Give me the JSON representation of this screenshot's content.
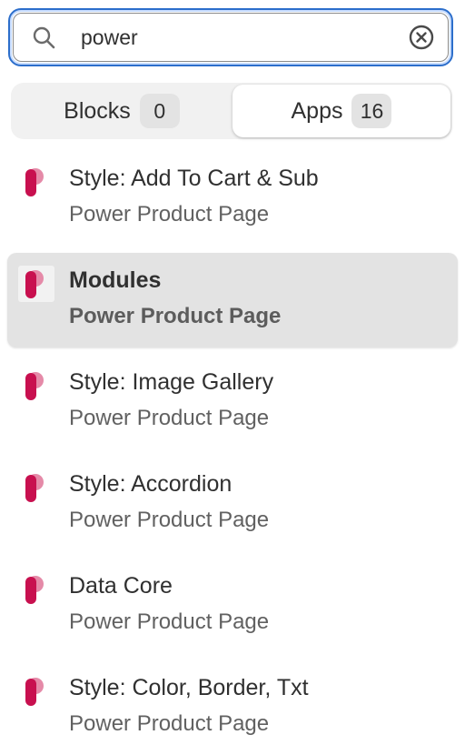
{
  "search": {
    "value": "power",
    "placeholder": "",
    "icon": "search-icon",
    "clear_icon": "clear-circle-icon",
    "focus_color": "#2c6ecb"
  },
  "tabs": [
    {
      "label": "Blocks",
      "count": "0",
      "selected": false
    },
    {
      "label": "Apps",
      "count": "16",
      "selected": true
    }
  ],
  "results": [
    {
      "title": "Style: Add To Cart & Sub",
      "subtitle": "Power Product Page",
      "selected": false
    },
    {
      "title": "Modules",
      "subtitle": "Power Product Page",
      "selected": true
    },
    {
      "title": "Style: Image Gallery",
      "subtitle": "Power Product Page",
      "selected": false
    },
    {
      "title": "Style: Accordion",
      "subtitle": "Power Product Page",
      "selected": false
    },
    {
      "title": "Data Core",
      "subtitle": "Power Product Page",
      "selected": false
    },
    {
      "title": "Style: Color, Border, Txt",
      "subtitle": "Power Product Page",
      "selected": false
    }
  ],
  "app_icon": {
    "name": "power-product-page-logo-icon",
    "primary_color": "#c8104f",
    "secondary_color": "#e58aa8"
  }
}
